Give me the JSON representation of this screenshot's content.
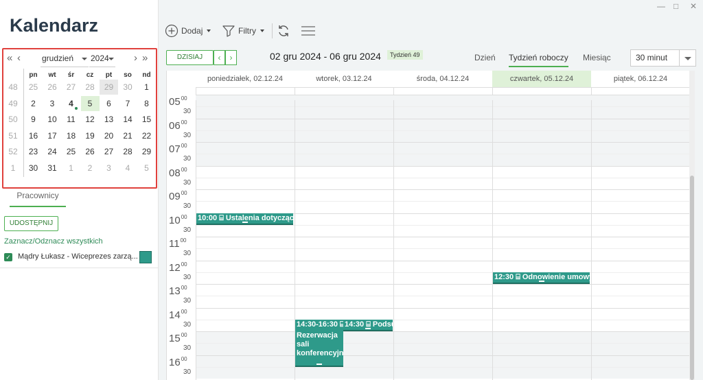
{
  "app": {
    "title": "Kalendarz"
  },
  "window": {
    "minimize": "—",
    "maximize": "□",
    "close": "✕"
  },
  "minical": {
    "prev_year": "«",
    "prev_month": "‹",
    "next_month": "›",
    "next_year": "»",
    "month": "grudzień",
    "year": "2024",
    "weekdays": [
      "pn",
      "wt",
      "śr",
      "cz",
      "pt",
      "so",
      "nd"
    ],
    "weeks": [
      {
        "num": "48",
        "days": [
          {
            "d": "25",
            "o": 1
          },
          {
            "d": "26",
            "o": 1
          },
          {
            "d": "27",
            "o": 1
          },
          {
            "d": "28",
            "o": 1
          },
          {
            "d": "29",
            "o": 1,
            "g": 1
          },
          {
            "d": "30",
            "o": 1
          },
          {
            "d": "1"
          }
        ]
      },
      {
        "num": "49",
        "days": [
          {
            "d": "2"
          },
          {
            "d": "3"
          },
          {
            "d": "4",
            "t": 1
          },
          {
            "d": "5",
            "s": 1
          },
          {
            "d": "6"
          },
          {
            "d": "7"
          },
          {
            "d": "8"
          }
        ]
      },
      {
        "num": "50",
        "days": [
          {
            "d": "9"
          },
          {
            "d": "10"
          },
          {
            "d": "11"
          },
          {
            "d": "12"
          },
          {
            "d": "13"
          },
          {
            "d": "14"
          },
          {
            "d": "15"
          }
        ]
      },
      {
        "num": "51",
        "days": [
          {
            "d": "16"
          },
          {
            "d": "17"
          },
          {
            "d": "18"
          },
          {
            "d": "19"
          },
          {
            "d": "20"
          },
          {
            "d": "21"
          },
          {
            "d": "22"
          }
        ]
      },
      {
        "num": "52",
        "days": [
          {
            "d": "23"
          },
          {
            "d": "24"
          },
          {
            "d": "25"
          },
          {
            "d": "26"
          },
          {
            "d": "27"
          },
          {
            "d": "28"
          },
          {
            "d": "29"
          }
        ]
      },
      {
        "num": "1",
        "days": [
          {
            "d": "30"
          },
          {
            "d": "31"
          },
          {
            "d": "1",
            "o": 1
          },
          {
            "d": "2",
            "o": 1
          },
          {
            "d": "3",
            "o": 1
          },
          {
            "d": "4",
            "o": 1
          },
          {
            "d": "5",
            "o": 1
          }
        ]
      }
    ]
  },
  "sidebar": {
    "tab": "Pracownicy",
    "share_label": "UDOSTĘPNIJ",
    "toggle_all": "Zaznacz/Odznacz wszystkich",
    "employee": "Mądry Łukasz - Wiceprezes zarzą...",
    "employee_color": "#2e9a8a"
  },
  "toolbar": {
    "add": "Dodaj",
    "filters": "Filtry"
  },
  "nav": {
    "today": "DZISIAJ",
    "prev": "‹",
    "next": "›",
    "range": "02 gru 2024 - 06 gru 2024",
    "week_badge": "Tydzień 49",
    "views": [
      "Dzień",
      "Tydzień roboczy",
      "Miesiąc"
    ],
    "interval": "30 minut"
  },
  "days": [
    "poniedziałek, 02.12.24",
    "wtorek, 03.12.24",
    "środa, 04.12.24",
    "czwartek, 05.12.24",
    "piątek, 06.12.24"
  ],
  "hours": [
    "05",
    "06",
    "07",
    "08",
    "09",
    "10",
    "11",
    "12",
    "13",
    "14",
    "15",
    "16"
  ],
  "minutes": {
    "full": "00",
    "half": "30"
  },
  "events": [
    {
      "time": "10:00",
      "title": "Ustalenia dotyczące"
    },
    {
      "time": "12:30",
      "title": "Odnowienie umowy"
    },
    {
      "time": "14:30-16:30",
      "title": "Rezerwacja sali konferencyjnej"
    },
    {
      "time": "14:30",
      "title": "Podsumowanie"
    }
  ],
  "accent_color": "#4caf50"
}
